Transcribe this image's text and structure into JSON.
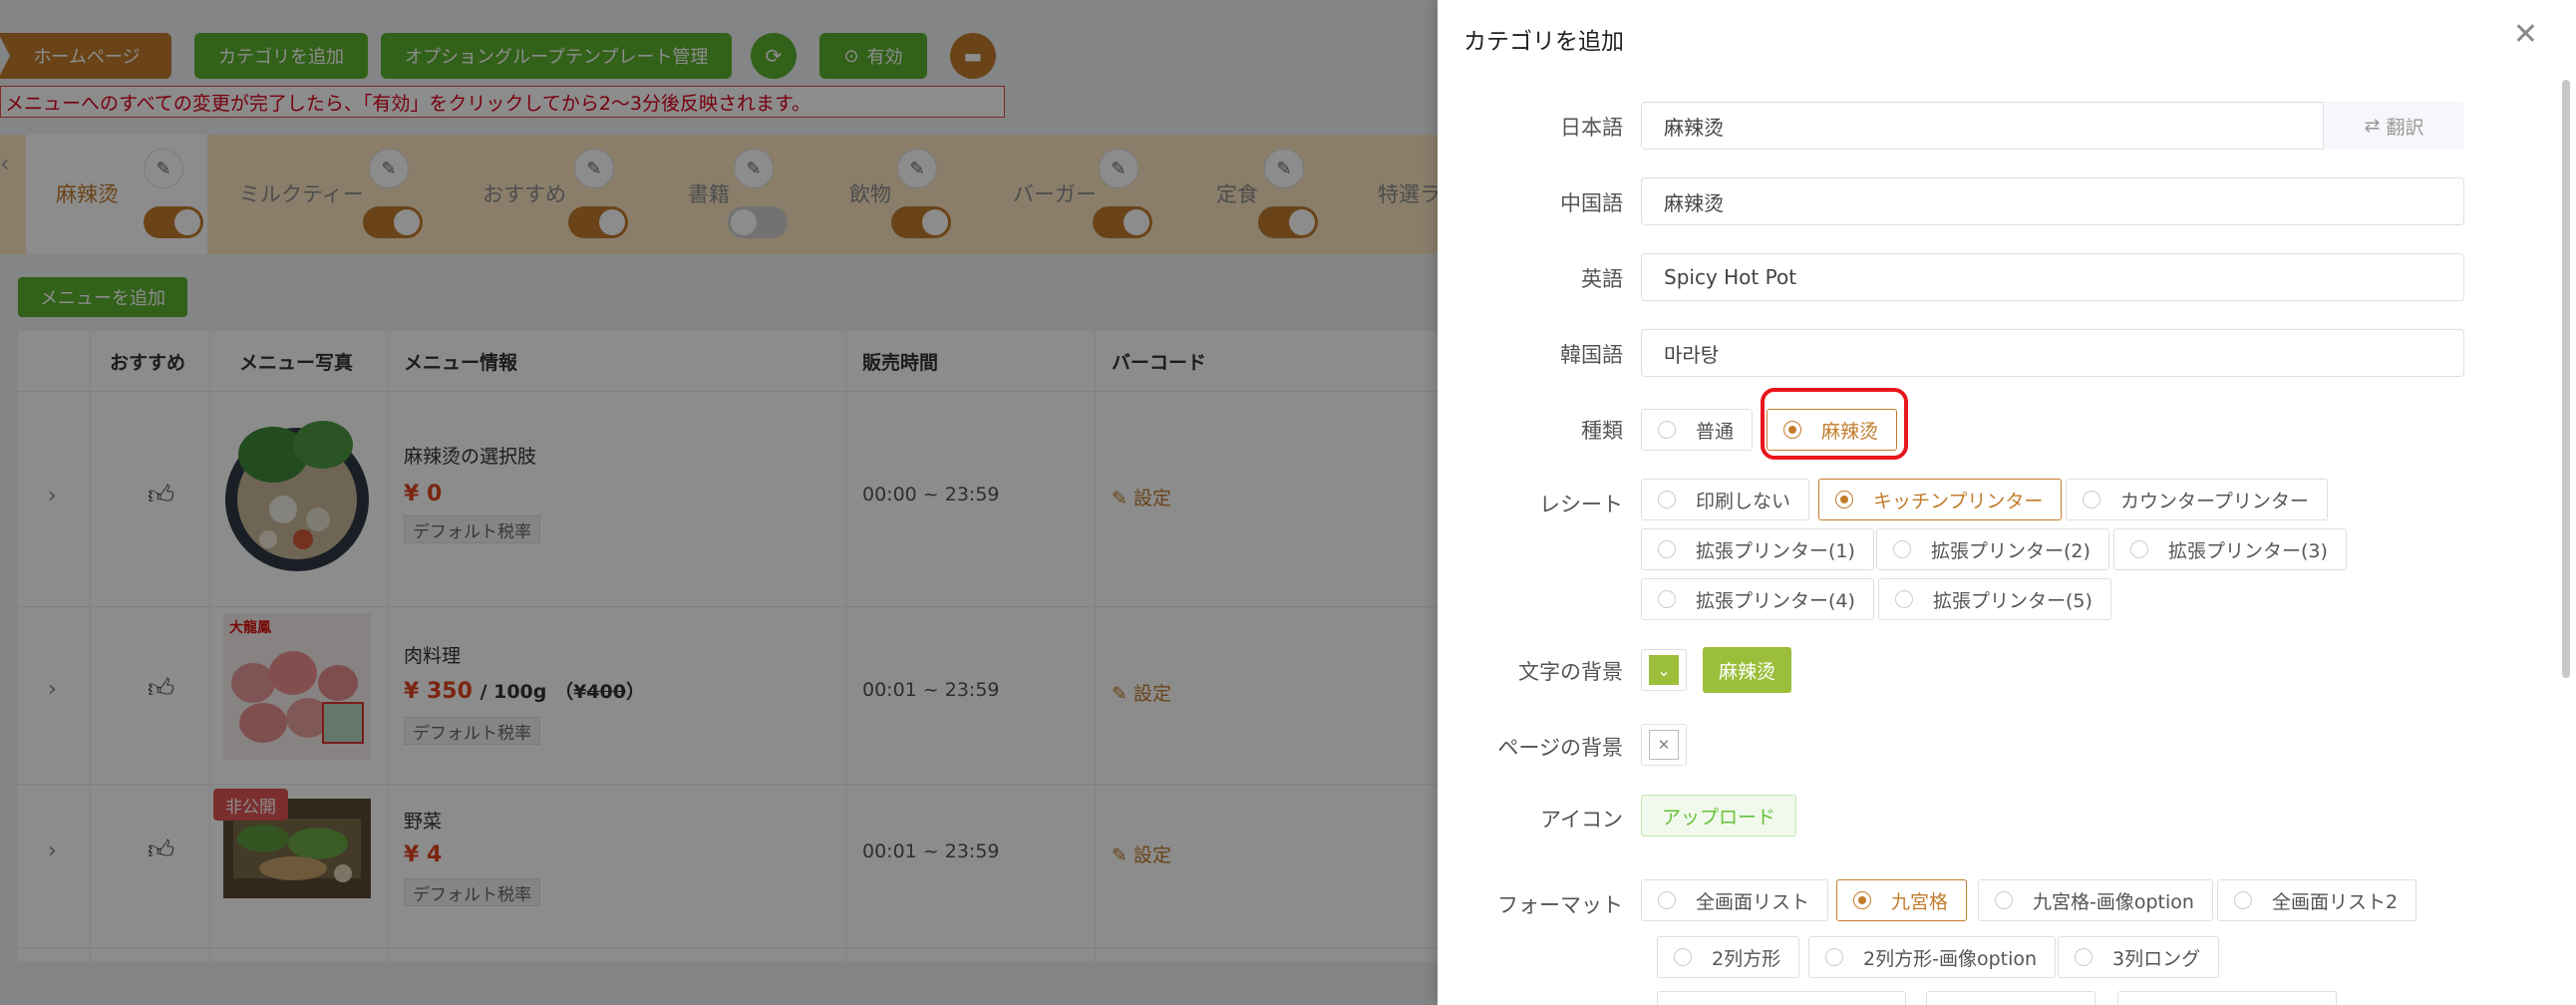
{
  "background": {
    "topbar": {
      "home": "ホームページ",
      "add_category": "カテゴリを追加",
      "option_group_template": "オプショングループテンプレート管理",
      "enable": "有効"
    },
    "notice": "メニューへのすべての変更が完了したら、「有効」をクリックしてから2～3分後反映されます。",
    "categories": [
      {
        "name": "麻辣烫",
        "enabled": true
      },
      {
        "name": "ミルクティー",
        "enabled": true
      },
      {
        "name": "おすすめ",
        "enabled": true
      },
      {
        "name": "書籍",
        "enabled": false
      },
      {
        "name": "飲物",
        "enabled": true
      },
      {
        "name": "バーガー",
        "enabled": true
      },
      {
        "name": "定食",
        "enabled": true
      },
      {
        "name": "特選ラ",
        "enabled": null
      }
    ],
    "add_menu": "メニューを追加",
    "columns": [
      "おすすめ",
      "メニュー写真",
      "メニュー情報",
      "販売時間",
      "バーコード"
    ],
    "rows": [
      {
        "name": "麻辣烫の選択肢",
        "price": "¥ 0",
        "unit": "",
        "orig_price": "",
        "tax": "デフォルト税率",
        "time": "00:00 ~ 23:59",
        "action": "設定",
        "badge": ""
      },
      {
        "name": "肉料理",
        "price": "¥ 350",
        "unit": "/ 100g",
        "orig_prefix": "（¥",
        "orig_price": "400",
        "orig_suffix": "）",
        "tax": "デフォルト税率",
        "time": "00:01 ~ 23:59",
        "action": "設定",
        "badge": ""
      },
      {
        "name": "野菜",
        "price": "¥ 4",
        "unit": "",
        "orig_price": "",
        "tax": "デフォルト税率",
        "time": "00:01 ~ 23:59",
        "action": "設定",
        "badge": "非公開"
      }
    ],
    "photo_caption": "大龍鳳"
  },
  "drawer": {
    "title": "カテゴリを追加",
    "fields": {
      "japanese": {
        "label": "日本語",
        "value": "麻辣烫",
        "translate": "翻訳"
      },
      "chinese": {
        "label": "中国語",
        "value": "麻辣烫"
      },
      "english": {
        "label": "英語",
        "value": "Spicy Hot Pot"
      },
      "korean": {
        "label": "韓国語",
        "value": "마라탕"
      }
    },
    "type": {
      "label": "種類",
      "options": [
        "普通",
        "麻辣烫"
      ],
      "selected": 1
    },
    "receipt": {
      "label": "レシート",
      "options": [
        "印刷しない",
        "キッチンプリンター",
        "カウンタープリンター",
        "拡張プリンター(1)",
        "拡張プリンター(2)",
        "拡張プリンター(3)",
        "拡張プリンター(4)",
        "拡張プリンター(5)"
      ],
      "selected": 1
    },
    "text_bg": {
      "label": "文字の背景",
      "preview": "麻辣烫",
      "color": "#9bbf3a"
    },
    "page_bg": {
      "label": "ページの背景"
    },
    "icon": {
      "label": "アイコン",
      "upload": "アップロード"
    },
    "format": {
      "label": "フォーマット",
      "options": [
        "全画面リスト",
        "九宮格",
        "九宮格-画像option",
        "全画面リスト2",
        "2列方形",
        "2列方形-画像option",
        "3列ロング"
      ],
      "selected": 1
    }
  },
  "colors": {
    "accent": "#c27c2c",
    "green": "#5bb12e",
    "highlight": "#e8161c"
  }
}
